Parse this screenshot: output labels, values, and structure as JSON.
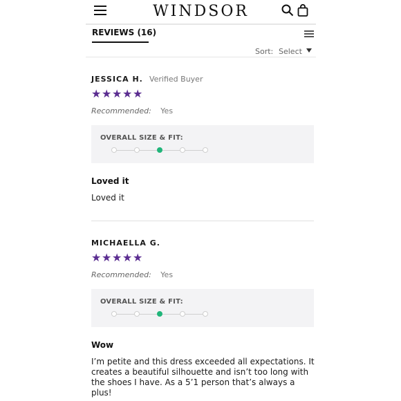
{
  "header": {
    "brand": "WINDSOR",
    "icons": [
      "menu-icon",
      "search-icon",
      "shopping-bag-icon"
    ]
  },
  "reviews_tab": {
    "label": "REVIEWS (16)",
    "sort_label": "Sort:",
    "sort_value": "Select"
  },
  "reviews": [
    {
      "name": "JESSICA H.",
      "verified": "Verified Buyer",
      "rating": 5,
      "recommended_label": "Recommended:",
      "recommended_value": "Yes",
      "fit_label": "OVERALL SIZE & FIT:",
      "fit_level": 3,
      "fit_scale": 5,
      "title": "Loved it",
      "body": "Loved it"
    },
    {
      "name": "MICHAELLA G.",
      "verified": "",
      "rating": 5,
      "recommended_label": "Recommended:",
      "recommended_value": "Yes",
      "fit_label": "OVERALL SIZE & FIT:",
      "fit_level": 3,
      "fit_scale": 5,
      "title": "Wow",
      "body": "I’m petite and this dress exceeded all expectations. It creates a beautiful silhouette and isn’t too long with the shoes I have. As a 5’1 person that’s always a plus!"
    }
  ],
  "colors": {
    "star": "#5b2d91",
    "fit_active": "#21b57a",
    "fit_box": "#f3f3f5"
  }
}
